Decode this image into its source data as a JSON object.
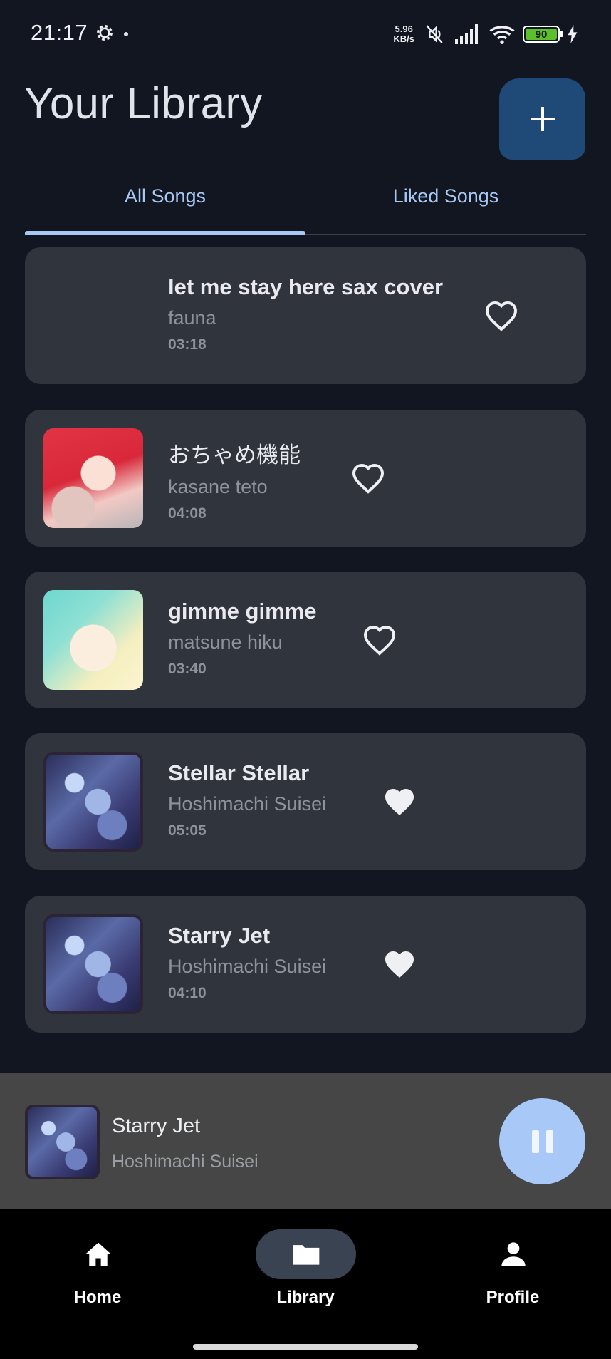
{
  "status_bar": {
    "time": "21:17",
    "net_speed_value": "5.96",
    "net_speed_unit": "KB/s",
    "battery_level": "90",
    "icons": [
      "gear-icon",
      "dot-icon",
      "mute-icon",
      "signal-icon",
      "wifi-icon",
      "battery-icon",
      "charging-icon"
    ]
  },
  "header": {
    "title": "Your Library",
    "add_icon": "plus-icon"
  },
  "tabs": [
    {
      "label": "All Songs",
      "active": true
    },
    {
      "label": "Liked Songs",
      "active": false
    }
  ],
  "songs": [
    {
      "title": "let me stay here sax cover",
      "artist": "fauna",
      "duration": "03:18",
      "liked": false,
      "thumbnail": "none"
    },
    {
      "title": "おちゃめ機能",
      "artist": "kasane teto",
      "duration": "04:08",
      "liked": false,
      "thumbnail": "teto-art"
    },
    {
      "title": "gimme gimme",
      "artist": "matsune hiku",
      "duration": "03:40",
      "liked": false,
      "thumbnail": "miku-art"
    },
    {
      "title": "Stellar Stellar",
      "artist": "Hoshimachi Suisei",
      "duration": "05:05",
      "liked": true,
      "thumbnail": "suisei-art"
    },
    {
      "title": "Starry Jet",
      "artist": "Hoshimachi Suisei",
      "duration": "04:10",
      "liked": true,
      "thumbnail": "suisei-art"
    }
  ],
  "now_playing": {
    "title": "Starry Jet",
    "artist": "Hoshimachi Suisei",
    "state_icon": "pause-icon"
  },
  "bottom_nav": [
    {
      "label": "Home",
      "icon": "home-icon",
      "active": false
    },
    {
      "label": "Library",
      "icon": "folder-icon",
      "active": true
    },
    {
      "label": "Profile",
      "icon": "person-icon",
      "active": false
    }
  ],
  "colors": {
    "background": "#111620",
    "card": "#30343d",
    "accent": "#a8c8f4",
    "add_button": "#1f4a78",
    "now_playing_bar": "#464646",
    "nav_active_pill": "#3a4352"
  }
}
